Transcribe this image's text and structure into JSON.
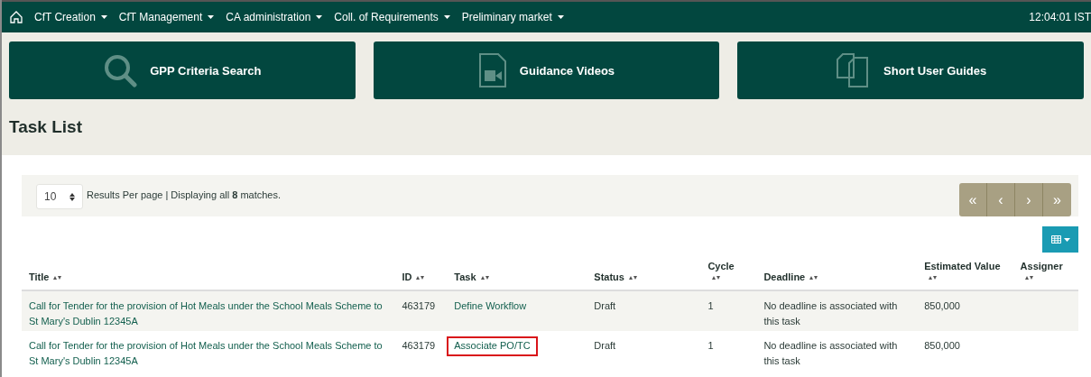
{
  "nav": {
    "items": [
      {
        "label": "CfT Creation"
      },
      {
        "label": "CfT Management"
      },
      {
        "label": "CA administration"
      },
      {
        "label": "Coll. of Requirements"
      },
      {
        "label": "Preliminary market"
      }
    ],
    "time": "12:04:01 IST"
  },
  "tiles": [
    {
      "kind": "search",
      "label": "GPP Criteria Search"
    },
    {
      "kind": "video",
      "label": "Guidance Videos"
    },
    {
      "kind": "docs",
      "label": "Short User Guides"
    }
  ],
  "heading": "Task List",
  "toolbar": {
    "per_page": "10",
    "summary": "Results Per page | Displaying all **8** matches.",
    "pager": [
      "«",
      "‹",
      "›",
      "»"
    ]
  },
  "table": {
    "columns": [
      {
        "label": "Title",
        "stacked": false
      },
      {
        "label": "ID",
        "stacked": false
      },
      {
        "label": "Task",
        "stacked": false
      },
      {
        "label": "Status",
        "stacked": false
      },
      {
        "label": "Cycle",
        "stacked": true
      },
      {
        "label": "Deadline",
        "stacked": false
      },
      {
        "label": "Estimated Value",
        "stacked": true
      },
      {
        "label": "Assigner",
        "stacked": true
      }
    ],
    "rows": [
      {
        "title": "Call for Tender for the provision of Hot Meals under the School Meals Scheme to St Mary's Dublin 12345A",
        "id": "463179",
        "task": "Define Workflow",
        "task_highlighted": false,
        "status": "Draft",
        "cycle": "1",
        "deadline": "No deadline is associated with this task",
        "value": "850,000"
      },
      {
        "title": "Call for Tender for the provision of Hot Meals under the School Meals Scheme to St Mary's Dublin 12345A",
        "id": "463179",
        "task": "Associate PO/TC",
        "task_highlighted": true,
        "status": "Draft",
        "cycle": "1",
        "deadline": "No deadline is associated with this task",
        "value": "850,000"
      }
    ]
  }
}
